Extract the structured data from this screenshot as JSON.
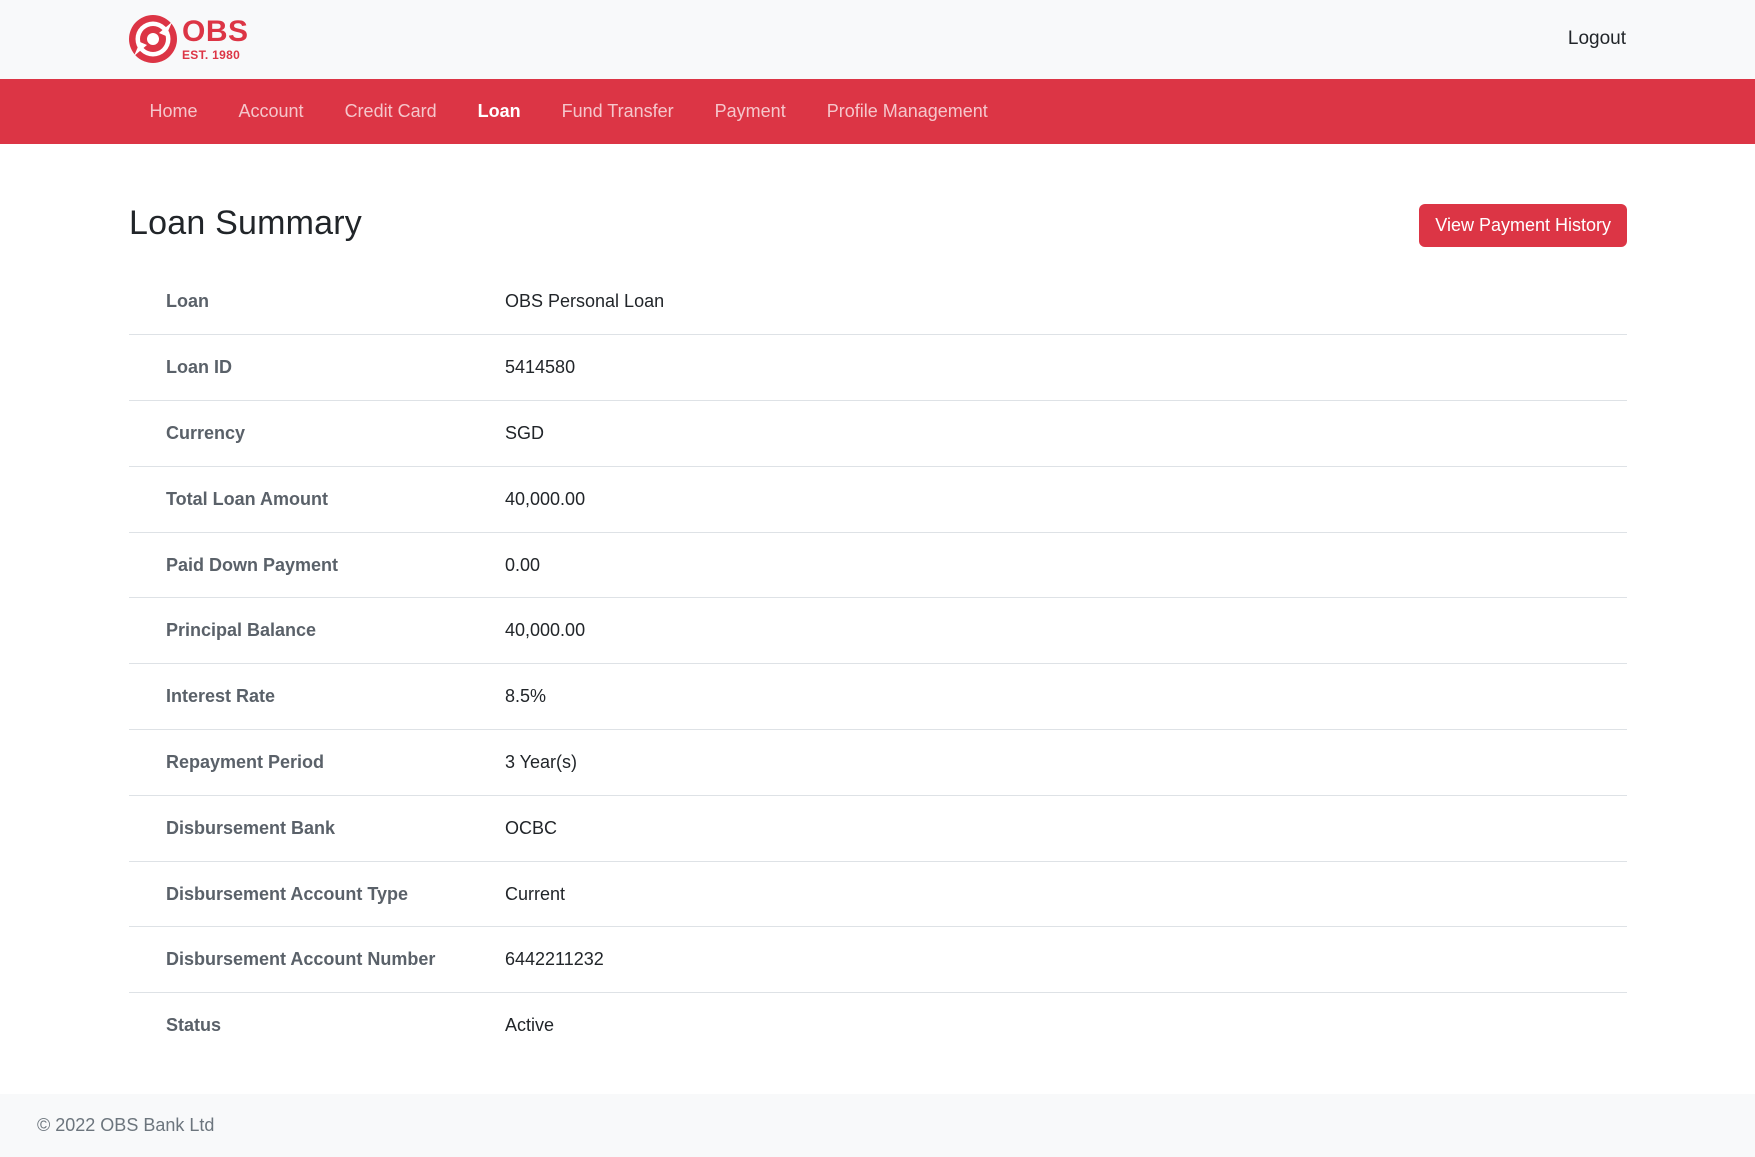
{
  "brand": {
    "name": "OBS",
    "est": "EST. 1980",
    "accent": "#dc3545"
  },
  "header": {
    "logout_label": "Logout"
  },
  "nav": {
    "items": [
      {
        "label": "Home"
      },
      {
        "label": "Account"
      },
      {
        "label": "Credit Card"
      },
      {
        "label": "Loan"
      },
      {
        "label": "Fund Transfer"
      },
      {
        "label": "Payment"
      },
      {
        "label": "Profile Management"
      }
    ],
    "active": "Loan"
  },
  "main": {
    "title": "Loan Summary",
    "history_button": "View Payment History",
    "rows": [
      {
        "label": "Loan",
        "value": "OBS Personal Loan"
      },
      {
        "label": "Loan ID",
        "value": "5414580"
      },
      {
        "label": "Currency",
        "value": "SGD"
      },
      {
        "label": "Total Loan Amount",
        "value": "40,000.00"
      },
      {
        "label": "Paid Down Payment",
        "value": "0.00"
      },
      {
        "label": "Principal Balance",
        "value": "40,000.00"
      },
      {
        "label": "Interest Rate",
        "value": "8.5%"
      },
      {
        "label": "Repayment Period",
        "value": "3 Year(s)"
      },
      {
        "label": "Disbursement Bank",
        "value": "OCBC"
      },
      {
        "label": "Disbursement Account Type",
        "value": "Current"
      },
      {
        "label": "Disbursement Account Number",
        "value": "6442211232"
      },
      {
        "label": "Status",
        "value": "Active"
      }
    ]
  },
  "footer": {
    "copyright": "© 2022 OBS Bank Ltd"
  }
}
